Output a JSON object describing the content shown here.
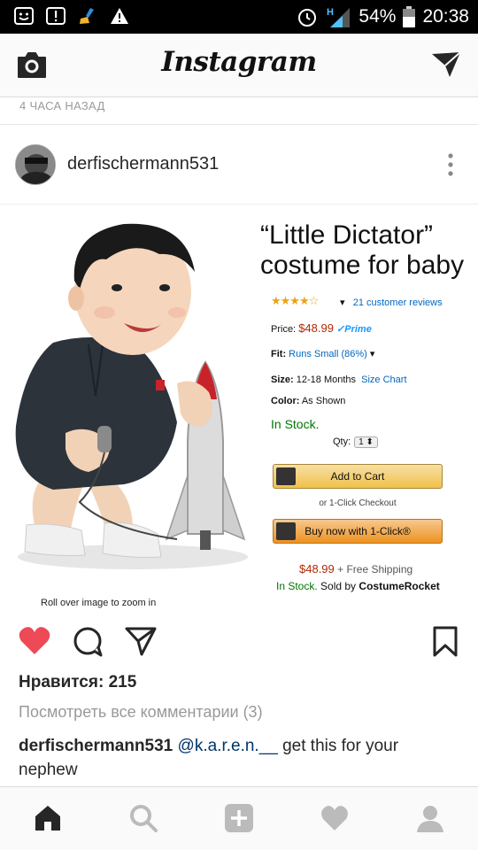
{
  "status_bar": {
    "battery": "54%",
    "time": "20:38",
    "network": "H",
    "icons": [
      "notification-smiley-icon",
      "alert-box-icon",
      "cleaner-icon",
      "warning-icon",
      "alarm-icon",
      "signal-icon",
      "battery-icon"
    ]
  },
  "app": {
    "title": "Instagram",
    "icons": [
      "camera-icon",
      "direct-message-icon"
    ]
  },
  "feed": {
    "timestamp": "4 ЧАСА НАЗАД"
  },
  "post": {
    "username": "derfischermann531",
    "image": {
      "ad_title": "“Little Dictator” costume for baby",
      "reviews": "21 customer reviews",
      "price_label": "Price:",
      "price": "$48.99",
      "prime": "Prime",
      "fit_label": "Fit:",
      "fit_value": "Runs Small (86%)",
      "size_label": "Size:",
      "size_value": "12-18 Months",
      "size_chart": "Size Chart",
      "color_label": "Color:",
      "color_value": "As Shown",
      "in_stock": "In Stock.",
      "qty_label": "Qty:",
      "qty_value": "1",
      "add_to_cart": "Add to Cart",
      "one_click_checkout": "or 1-Click Checkout",
      "buy_now": "Buy now with 1-Click®",
      "shipping_price": "$48.99",
      "free_shipping": "+ Free Shipping",
      "stock_line": "In Stock.",
      "sold_by": "Sold by",
      "seller": "CostumeRocket",
      "zoom_hint": "Roll over image to zoom in",
      "star_rating_fraction": 0.7
    },
    "likes": "Нравится: 215",
    "view_comments": "Посмотреть все комментарии (3)",
    "caption": {
      "user": "derfischermann531",
      "mention": "@k.a.r.e.n.__",
      "text": " get this for your nephew"
    },
    "liked": true
  },
  "bottom_nav": {
    "items": [
      "home-icon",
      "search-icon",
      "add-post-icon",
      "activity-heart-icon",
      "profile-icon"
    ],
    "active": "home-icon"
  },
  "colors": {
    "like_red": "#ed4956",
    "link_navy": "#003569",
    "amazon_price": "#b12704",
    "amazon_stock": "#007600"
  }
}
